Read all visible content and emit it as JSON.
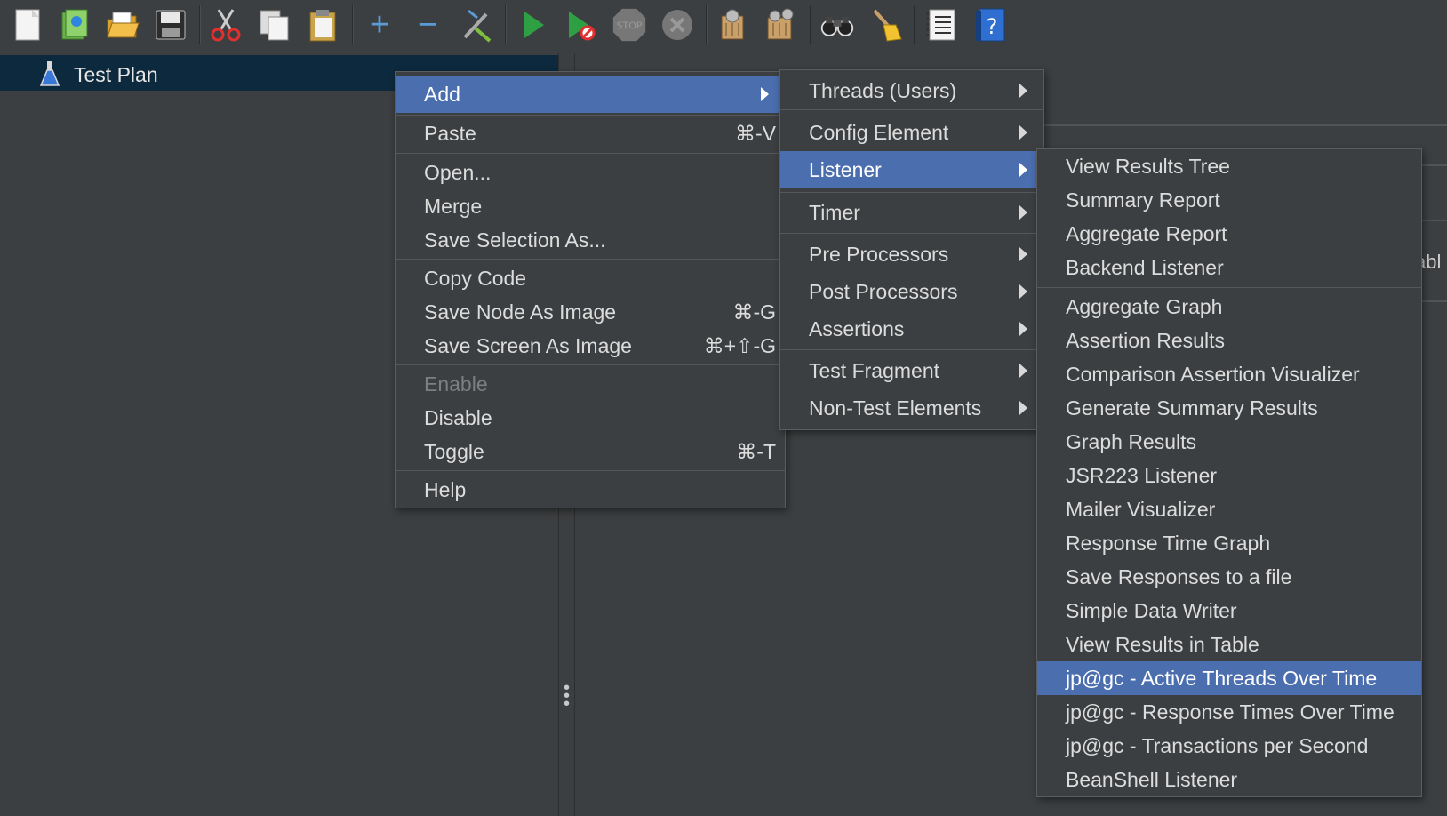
{
  "toolbar": {
    "icons": [
      "new-icon",
      "templates-icon",
      "open-icon",
      "save-icon",
      "cut-icon",
      "copy-icon",
      "paste-icon",
      "expand-icon",
      "collapse-icon",
      "toggle-icon",
      "start-icon",
      "start-no-pauses-icon",
      "stop-icon",
      "shutdown-icon",
      "clear-icon",
      "clear-all-icon",
      "search-icon",
      "reset-search-icon",
      "function-helper-icon",
      "help-icon"
    ]
  },
  "tree": {
    "root_label": "Test Plan"
  },
  "right_panel": {
    "fragment_text": "abl"
  },
  "context_menu": {
    "items": [
      {
        "label": "Add",
        "shortcut": "",
        "submenu": true,
        "selected": true
      },
      {
        "label": "Paste",
        "shortcut": "⌘-V"
      },
      {
        "label": "Open..."
      },
      {
        "label": "Merge"
      },
      {
        "label": "Save Selection As..."
      },
      {
        "label": "Copy Code"
      },
      {
        "label": "Save Node As Image",
        "shortcut": "⌘-G"
      },
      {
        "label": "Save Screen As Image",
        "shortcut": "⌘+⇧-G"
      },
      {
        "label": "Enable",
        "disabled": true
      },
      {
        "label": "Disable"
      },
      {
        "label": "Toggle",
        "shortcut": "⌘-T"
      },
      {
        "label": "Help"
      }
    ]
  },
  "add_submenu": {
    "items": [
      {
        "label": "Threads (Users)"
      },
      {
        "label": "Config Element"
      },
      {
        "label": "Listener",
        "selected": true
      },
      {
        "label": "Timer"
      },
      {
        "label": "Pre Processors"
      },
      {
        "label": "Post Processors"
      },
      {
        "label": "Assertions"
      },
      {
        "label": "Test Fragment"
      },
      {
        "label": "Non-Test Elements"
      }
    ]
  },
  "listener_submenu": {
    "items": [
      {
        "label": "View Results Tree"
      },
      {
        "label": "Summary Report"
      },
      {
        "label": "Aggregate Report"
      },
      {
        "label": "Backend Listener"
      },
      {
        "label": "Aggregate Graph"
      },
      {
        "label": "Assertion Results"
      },
      {
        "label": "Comparison Assertion Visualizer"
      },
      {
        "label": "Generate Summary Results"
      },
      {
        "label": "Graph Results"
      },
      {
        "label": "JSR223 Listener"
      },
      {
        "label": "Mailer Visualizer"
      },
      {
        "label": "Response Time Graph"
      },
      {
        "label": "Save Responses to a file"
      },
      {
        "label": "Simple Data Writer"
      },
      {
        "label": "View Results in Table"
      },
      {
        "label": "jp@gc - Active Threads Over Time",
        "selected": true
      },
      {
        "label": "jp@gc - Response Times Over Time"
      },
      {
        "label": "jp@gc - Transactions per Second"
      },
      {
        "label": "BeanShell Listener"
      }
    ]
  },
  "colors": {
    "background": "#3c3f41",
    "selection": "#4b6eaf",
    "tree_selection": "#0d293e",
    "text": "#dcdcdc",
    "disabled_text": "#7c7f82"
  }
}
